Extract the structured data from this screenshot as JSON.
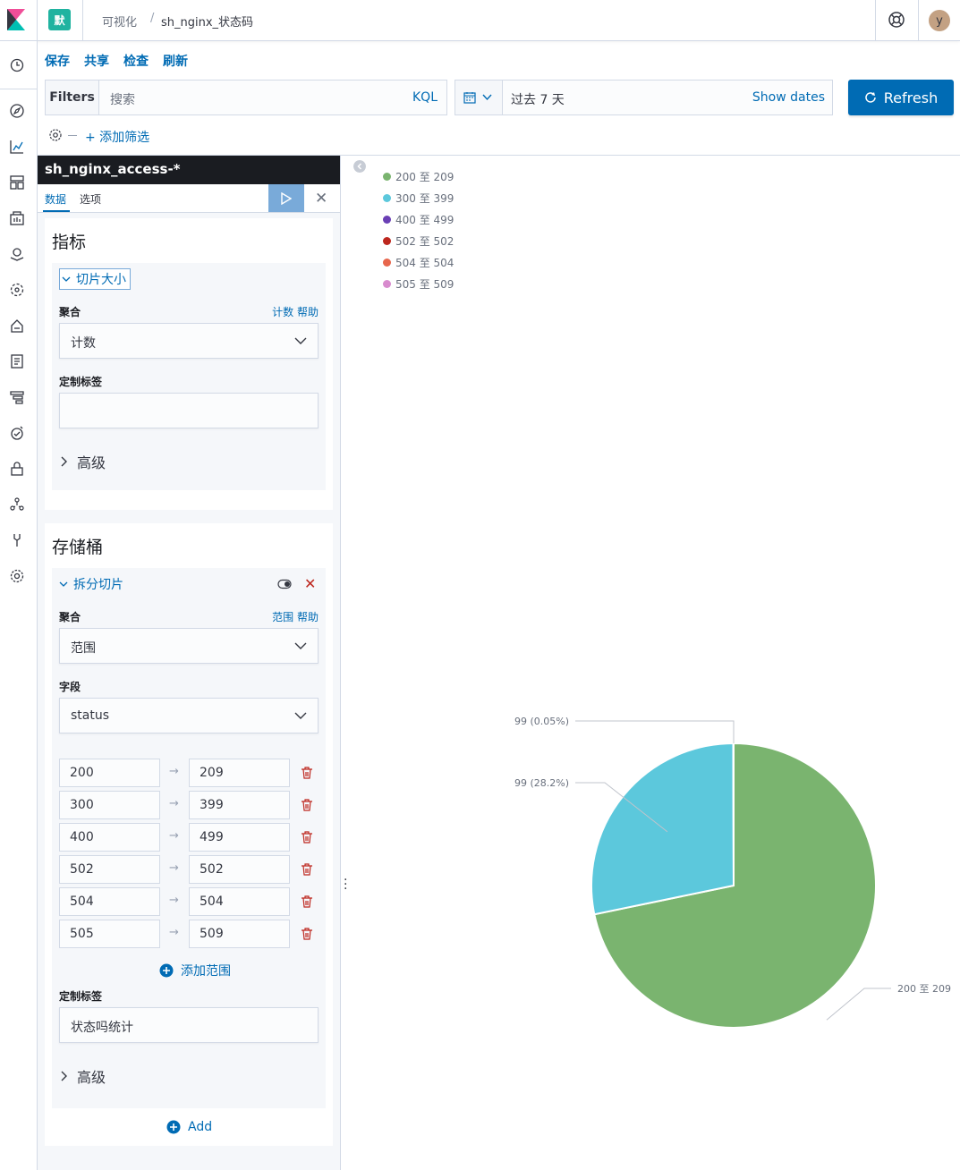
{
  "header": {
    "space_initial": "默",
    "breadcrumbs": [
      "可视化",
      "sh_nginx_状态码"
    ],
    "user_initial": "y"
  },
  "menu": [
    "保存",
    "共享",
    "检查",
    "刷新"
  ],
  "querybar": {
    "filters_label": "Filters",
    "search_placeholder": "搜索",
    "language": "KQL",
    "time_range": "过去 7 天",
    "show_dates": "Show dates",
    "refresh_label": "Refresh",
    "add_filter": "+ 添加筛选"
  },
  "editor": {
    "index_pattern": "sh_nginx_access-*",
    "tabs": [
      "数据",
      "选项"
    ],
    "metrics": {
      "title": "指标",
      "agg_button": "切片大小",
      "agg_label": "聚合",
      "agg_help": "计数 帮助",
      "agg_value": "计数",
      "custom_label": "定制标签",
      "custom_value": "",
      "advanced": "高级"
    },
    "buckets": {
      "title": "存储桶",
      "agg_button": "拆分切片",
      "agg_label": "聚合",
      "agg_help": "范围 帮助",
      "agg_value": "范围",
      "field_label": "字段",
      "field_value": "status",
      "ranges": [
        {
          "from": "200",
          "to": "209"
        },
        {
          "from": "300",
          "to": "399"
        },
        {
          "from": "400",
          "to": "499"
        },
        {
          "from": "502",
          "to": "502"
        },
        {
          "from": "504",
          "to": "504"
        },
        {
          "from": "505",
          "to": "509"
        }
      ],
      "add_range": "添加范围",
      "custom_label": "定制标签",
      "custom_value": "状态吗统计",
      "advanced": "高级",
      "add": "Add"
    }
  },
  "legend": [
    {
      "label": "200 至 209",
      "color": "#7ab46f"
    },
    {
      "label": "300 至 399",
      "color": "#5cc8dc"
    },
    {
      "label": "400 至 499",
      "color": "#6a3fb5"
    },
    {
      "label": "502 至 502",
      "color": "#bd271e"
    },
    {
      "label": "504 至 504",
      "color": "#e7664c"
    },
    {
      "label": "505 至 509",
      "color": "#d88bce"
    }
  ],
  "chart_data": {
    "type": "pie",
    "slices": [
      {
        "name": "200 至 209",
        "percent": 71.75,
        "color": "#7ab46f"
      },
      {
        "name": "300 至 399",
        "percent": 28.2,
        "color": "#5cc8dc"
      },
      {
        "name": "400 至 499",
        "percent": 0.05,
        "color": "#6a3fb5"
      }
    ],
    "labels": [
      "99 (0.05%)",
      "99 (28.2%)",
      "200 至 209"
    ]
  }
}
